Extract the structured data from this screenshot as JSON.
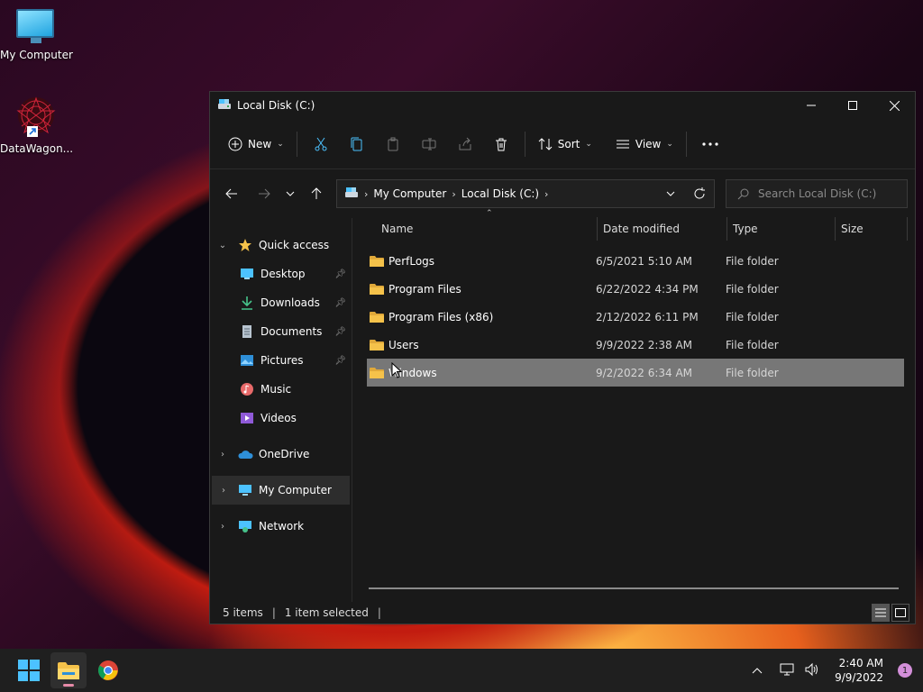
{
  "desktop": {
    "icons": [
      {
        "label": "My Computer"
      },
      {
        "label": "DataWagon..."
      }
    ]
  },
  "window": {
    "title": "Local Disk (C:)",
    "toolbar": {
      "new_label": "New",
      "sort_label": "Sort",
      "view_label": "View"
    },
    "address": {
      "crumbs": [
        "My Computer",
        "Local Disk (C:)"
      ]
    },
    "search": {
      "placeholder": "Search Local Disk (C:)"
    },
    "nav": {
      "quick_access": "Quick access",
      "items": [
        {
          "label": "Desktop",
          "icon": "desktop-icon",
          "pinned": true
        },
        {
          "label": "Downloads",
          "icon": "downloads-icon",
          "pinned": true
        },
        {
          "label": "Documents",
          "icon": "documents-icon",
          "pinned": true
        },
        {
          "label": "Pictures",
          "icon": "pictures-icon",
          "pinned": true
        },
        {
          "label": "Music",
          "icon": "music-icon",
          "pinned": false
        },
        {
          "label": "Videos",
          "icon": "videos-icon",
          "pinned": false
        }
      ],
      "onedrive": "OneDrive",
      "my_computer": "My Computer",
      "network": "Network"
    },
    "columns": {
      "name": "Name",
      "date": "Date modified",
      "type": "Type",
      "size": "Size"
    },
    "files": [
      {
        "name": "PerfLogs",
        "date": "6/5/2021 5:10 AM",
        "type": "File folder",
        "selected": false
      },
      {
        "name": "Program Files",
        "date": "6/22/2022 4:34 PM",
        "type": "File folder",
        "selected": false
      },
      {
        "name": "Program Files (x86)",
        "date": "2/12/2022 6:11 PM",
        "type": "File folder",
        "selected": false
      },
      {
        "name": "Users",
        "date": "9/9/2022 2:38 AM",
        "type": "File folder",
        "selected": false
      },
      {
        "name": "Windows",
        "date": "9/2/2022 6:34 AM",
        "type": "File folder",
        "selected": true
      }
    ],
    "status": {
      "items": "5 items",
      "selected": "1 item selected"
    }
  },
  "taskbar": {
    "time": "2:40 AM",
    "date": "9/9/2022",
    "notifications": "1"
  },
  "colors": {
    "accent": "#4cc2ff",
    "folder": "#f5c24a",
    "window_bg": "#191919",
    "selection": "#777777"
  }
}
